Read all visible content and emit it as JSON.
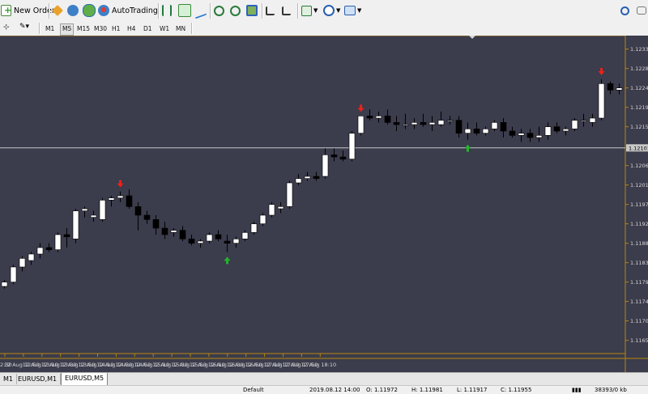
{
  "toolbar": {
    "new_order": "New Order",
    "auto_trading": "AutoTrading",
    "timeframes": [
      "M1",
      "M5",
      "M15",
      "M30",
      "H1",
      "H4",
      "D1",
      "W1",
      "MN"
    ],
    "active_timeframe": "M5"
  },
  "chart": {
    "current_price_label": "1.12101",
    "price_labels": [
      "1.12330",
      "1.12285",
      "1.12240",
      "1.12195",
      "1.12150",
      "1.12060",
      "1.12015",
      "1.11970",
      "1.11925",
      "1.11880",
      "1.11835",
      "1.11790",
      "1.11745",
      "1.11700",
      "1.11655"
    ],
    "time_labels": [
      "2:30",
      "12 Aug 12:50",
      "12 Aug 13:10",
      "12 Aug 13:30",
      "12 Aug 13:50",
      "12 Aug 14:10",
      "12 Aug 14:30",
      "12 Aug 14:50",
      "12 Aug 15:10",
      "12 Aug 15:30",
      "12 Aug 15:50",
      "12 Aug 16:10",
      "12 Aug 16:30",
      "12 Aug 16:50",
      "12 Aug 17:10",
      "12 Aug 17:30",
      "12 Aug 17:50",
      "12 Aug 18:10"
    ]
  },
  "chart_data": {
    "type": "candlestick",
    "symbol": "EURUSD",
    "timeframe": "M5",
    "ylim": [
      1.1163,
      1.1235
    ],
    "current_price": 1.12101,
    "candles": [
      [
        1.1178,
        1.11795,
        1.11775,
        1.1179
      ],
      [
        1.1179,
        1.1183,
        1.11785,
        1.11825
      ],
      [
        1.11825,
        1.1185,
        1.11815,
        1.11845
      ],
      [
        1.1184,
        1.1186,
        1.1183,
        1.11855
      ],
      [
        1.11855,
        1.1188,
        1.11845,
        1.1187
      ],
      [
        1.1187,
        1.1188,
        1.1186,
        1.11865
      ],
      [
        1.11865,
        1.11905,
        1.1186,
        1.119
      ],
      [
        1.119,
        1.11915,
        1.1187,
        1.11895
      ],
      [
        1.1189,
        1.1196,
        1.1188,
        1.11955
      ],
      [
        1.11955,
        1.11965,
        1.1194,
        1.1196
      ],
      [
        1.1194,
        1.11955,
        1.1193,
        1.11945
      ],
      [
        1.11935,
        1.11985,
        1.1193,
        1.1198
      ],
      [
        1.1198,
        1.1199,
        1.11965,
        1.11985
      ],
      [
        1.11985,
        1.12,
        1.11975,
        1.1199
      ],
      [
        1.1199,
        1.12005,
        1.1196,
        1.11965
      ],
      [
        1.11965,
        1.11975,
        1.1191,
        1.11945
      ],
      [
        1.11945,
        1.11955,
        1.11925,
        1.11935
      ],
      [
        1.11935,
        1.11945,
        1.119,
        1.11915
      ],
      [
        1.11915,
        1.1193,
        1.1189,
        1.119
      ],
      [
        1.11905,
        1.11915,
        1.11895,
        1.1191
      ],
      [
        1.1191,
        1.1192,
        1.11885,
        1.1189
      ],
      [
        1.1189,
        1.119,
        1.11875,
        1.1188
      ],
      [
        1.1188,
        1.1189,
        1.1187,
        1.11885
      ],
      [
        1.11885,
        1.11905,
        1.1188,
        1.119
      ],
      [
        1.119,
        1.1191,
        1.11885,
        1.1189
      ],
      [
        1.11885,
        1.119,
        1.1186,
        1.1188
      ],
      [
        1.1188,
        1.11895,
        1.1187,
        1.1189
      ],
      [
        1.1189,
        1.1191,
        1.11885,
        1.11905
      ],
      [
        1.11905,
        1.1193,
        1.119,
        1.11925
      ],
      [
        1.11925,
        1.1195,
        1.1192,
        1.11945
      ],
      [
        1.11945,
        1.11975,
        1.1194,
        1.1197
      ],
      [
        1.1196,
        1.11975,
        1.1195,
        1.11965
      ],
      [
        1.11965,
        1.12025,
        1.1196,
        1.1202
      ],
      [
        1.1202,
        1.1204,
        1.12015,
        1.1203
      ],
      [
        1.1203,
        1.12045,
        1.12025,
        1.12035
      ],
      [
        1.12035,
        1.12045,
        1.12025,
        1.1203
      ],
      [
        1.12035,
        1.121,
        1.1203,
        1.12085
      ],
      [
        1.12085,
        1.121,
        1.1207,
        1.1208
      ],
      [
        1.1208,
        1.12095,
        1.1207,
        1.12075
      ],
      [
        1.12075,
        1.1214,
        1.1207,
        1.12135
      ],
      [
        1.12135,
        1.12175,
        1.1213,
        1.12175
      ],
      [
        1.12175,
        1.1219,
        1.12165,
        1.1217
      ],
      [
        1.1217,
        1.12185,
        1.1216,
        1.12175
      ],
      [
        1.12175,
        1.1219,
        1.12155,
        1.1216
      ],
      [
        1.1216,
        1.12175,
        1.1214,
        1.12155
      ],
      [
        1.12155,
        1.1218,
        1.12145,
        1.12155
      ],
      [
        1.12155,
        1.1217,
        1.12145,
        1.1216
      ],
      [
        1.1216,
        1.1218,
        1.1215,
        1.12155
      ],
      [
        1.12155,
        1.12175,
        1.1214,
        1.1216
      ],
      [
        1.12155,
        1.12185,
        1.1215,
        1.12165
      ],
      [
        1.12165,
        1.12175,
        1.12155,
        1.12165
      ],
      [
        1.12165,
        1.12175,
        1.12125,
        1.12135
      ],
      [
        1.12135,
        1.1216,
        1.1212,
        1.12145
      ],
      [
        1.12145,
        1.1216,
        1.1213,
        1.12135
      ],
      [
        1.12135,
        1.1215,
        1.1213,
        1.12145
      ],
      [
        1.12145,
        1.12165,
        1.1214,
        1.1216
      ],
      [
        1.1216,
        1.1217,
        1.12125,
        1.1214
      ],
      [
        1.1214,
        1.1215,
        1.12125,
        1.1213
      ],
      [
        1.1213,
        1.12145,
        1.12115,
        1.12135
      ],
      [
        1.12135,
        1.12145,
        1.12115,
        1.12125
      ],
      [
        1.12125,
        1.1215,
        1.12115,
        1.1213
      ],
      [
        1.1213,
        1.1216,
        1.1212,
        1.1215
      ],
      [
        1.1215,
        1.1216,
        1.12135,
        1.1214
      ],
      [
        1.1214,
        1.1215,
        1.1213,
        1.12145
      ],
      [
        1.12145,
        1.1217,
        1.1214,
        1.12165
      ],
      [
        1.12165,
        1.1218,
        1.1215,
        1.12165
      ],
      [
        1.1216,
        1.1218,
        1.1215,
        1.1217
      ],
      [
        1.1217,
        1.1226,
        1.12165,
        1.1225
      ],
      [
        1.1225,
        1.12255,
        1.12225,
        1.12235
      ],
      [
        1.12235,
        1.1225,
        1.12225,
        1.1224
      ]
    ],
    "sell_arrow_candles": [
      13,
      40,
      67
    ],
    "buy_arrow_candles": [
      25,
      52
    ]
  },
  "tabs": [
    "M1",
    "EURUSD,M1",
    "EURUSD,M5"
  ],
  "active_tab": "EURUSD,M5",
  "status": {
    "profile": "Default",
    "datetime": "2019.08.12 14:00",
    "open": "O: 1.11972",
    "high": "H: 1.11981",
    "low": "L: 1.11917",
    "close": "C: 1.11955",
    "traffic": "38393/0 kb"
  },
  "colors": {
    "chart_bg": "#3b3c4c",
    "bull_candle": "#ffffff",
    "bear_candle": "#000000",
    "sell_arrow": "#e8221b",
    "buy_arrow": "#25b22e",
    "current_price_line": "#c8c8c8",
    "border_gold": "#b8860b"
  }
}
